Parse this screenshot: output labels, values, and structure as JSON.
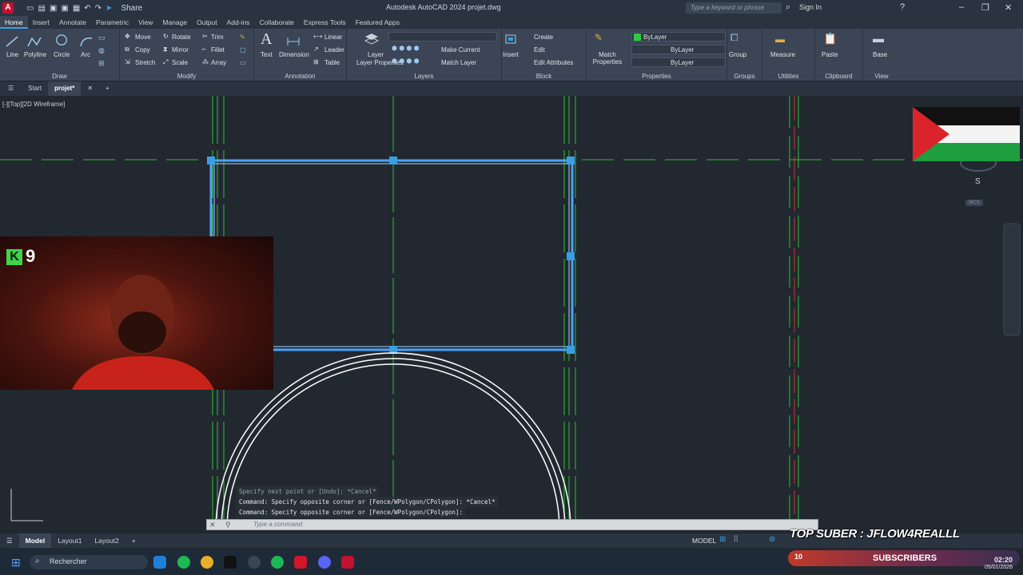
{
  "window": {
    "title": "Autodesk AutoCAD 2024   projet.dwg",
    "search_placeholder": "Type a keyword or phrase",
    "sign_in": "Sign In",
    "share": "Share",
    "app_letter": "A"
  },
  "ribbon_tabs": [
    "Home",
    "Insert",
    "Annotate",
    "Parametric",
    "View",
    "Manage",
    "Output",
    "Add-ins",
    "Collaborate",
    "Express Tools",
    "Featured Apps"
  ],
  "draw_panel": {
    "label": "Draw",
    "tools": [
      "Line",
      "Polyline",
      "Circle",
      "Arc"
    ]
  },
  "modify_panel": {
    "label": "Modify",
    "tools": [
      "Move",
      "Rotate",
      "Trim",
      "Copy",
      "Mirror",
      "Fillet",
      "Stretch",
      "Scale",
      "Array"
    ]
  },
  "annotation_panel": {
    "label": "Annotation",
    "tools": [
      "Text",
      "Dimension",
      "Linear",
      "Leader",
      "Table"
    ]
  },
  "layers_panel": {
    "label": "Layers",
    "tools": [
      "Layer Properties",
      "Make Current",
      "Match Layer"
    ]
  },
  "block_panel": {
    "label": "Block",
    "tools": [
      "Insert",
      "Create",
      "Edit",
      "Edit Attributes"
    ]
  },
  "properties_panel": {
    "label": "Properties",
    "match": "Match Properties",
    "color": "ByLayer",
    "linetype": "ByLayer",
    "lineweight": "ByLayer",
    "color_swatch": "#2ecc40"
  },
  "groups_panel": {
    "label": "Groups",
    "tool": "Group"
  },
  "utilities_panel": {
    "label": "Utilities",
    "tool": "Measure"
  },
  "clipboard_panel": {
    "label": "Clipboard",
    "tool": "Paste"
  },
  "view_panel": {
    "label": "View",
    "tool": "Base"
  },
  "doc_tabs": {
    "start": "Start",
    "current": "projet*"
  },
  "viewport_label": "[-][Top][2D Wireframe]",
  "viewcube_letter": "S",
  "viewcube_wcs": "WCS",
  "webcam": {
    "badge_letter": "K",
    "badge_number": "9"
  },
  "command": {
    "history": [
      "Specify next point or [Undo]: *Cancel*",
      "Command: Specify opposite corner or [Fence/WPolygon/CPolygon]: *Cancel*",
      "Command: Specify opposite corner or [Fence/WPolygon/CPolygon]:"
    ],
    "placeholder": "Type a command"
  },
  "layout_tabs": [
    "Model",
    "Layout1",
    "Layout2"
  ],
  "status_model": "MODEL",
  "overlay": {
    "top_suber": "TOP SUBER : JFLOW4REALLL",
    "sub_count": "10",
    "sub_label": "SUBSCRIBERS"
  },
  "taskbar": {
    "search": "Rechercher",
    "time": "02:20",
    "date": "05/01/2026"
  },
  "colors": {
    "accent": "#3a9ee5",
    "grid_green": "#2fbf2f",
    "selection_blue": "#4aa3ff",
    "red_axis": "#d03030"
  }
}
